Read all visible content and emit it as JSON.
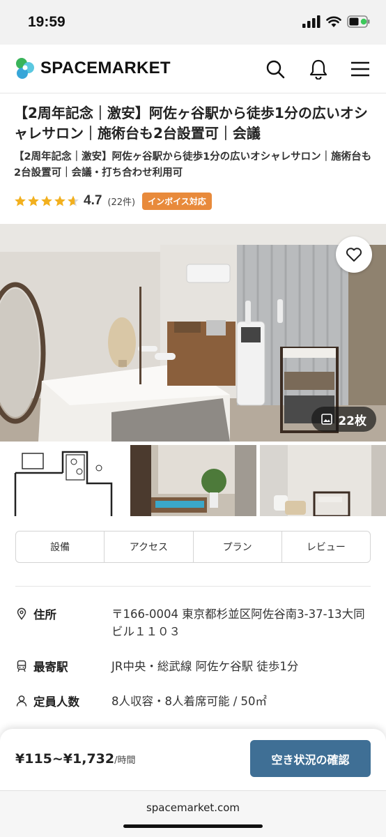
{
  "status_bar": {
    "time": "19:59"
  },
  "header": {
    "logo_text": "SPACEMARKET",
    "icons": [
      "search-icon",
      "bell-icon",
      "menu-icon"
    ]
  },
  "listing": {
    "title": "【2周年記念｜激安】阿佐ヶ谷駅から徒歩1分の広いオシャレサロン｜施術台も2台設置可｜会議",
    "subtitle": "【2周年記念｜激安】阿佐ヶ谷駅から徒歩1分の広いオシャレサロン｜施術台も2台設置可｜会議・打ち合わせ利用可",
    "rating": {
      "value": "4.7",
      "stars": 4.7,
      "count_label": "(22件)"
    },
    "badge": "インボイス対応"
  },
  "gallery": {
    "photo_count_label": "22枚"
  },
  "tabs": [
    {
      "label": "設備"
    },
    {
      "label": "アクセス"
    },
    {
      "label": "プラン"
    },
    {
      "label": "レビュー"
    }
  ],
  "info": {
    "address": {
      "label": "住所",
      "value": "〒166-0004  東京都杉並区阿佐谷南3-37-13大同ビル１１０３"
    },
    "station": {
      "label": "最寄駅",
      "value": "JR中央・総武線 阿佐ケ谷駅 徒歩1分"
    },
    "capacity": {
      "label": "定員人数",
      "value": "8人収容・8人着席可能 / 50㎡"
    }
  },
  "booking": {
    "price": "¥115~¥1,732",
    "price_unit": "/時間",
    "cta_label": "空き状況の確認"
  },
  "browser": {
    "url": "spacemarket.com"
  },
  "colors": {
    "accent": "#3f6f95",
    "badge": "#e88a3b",
    "star": "#f2b01e"
  }
}
